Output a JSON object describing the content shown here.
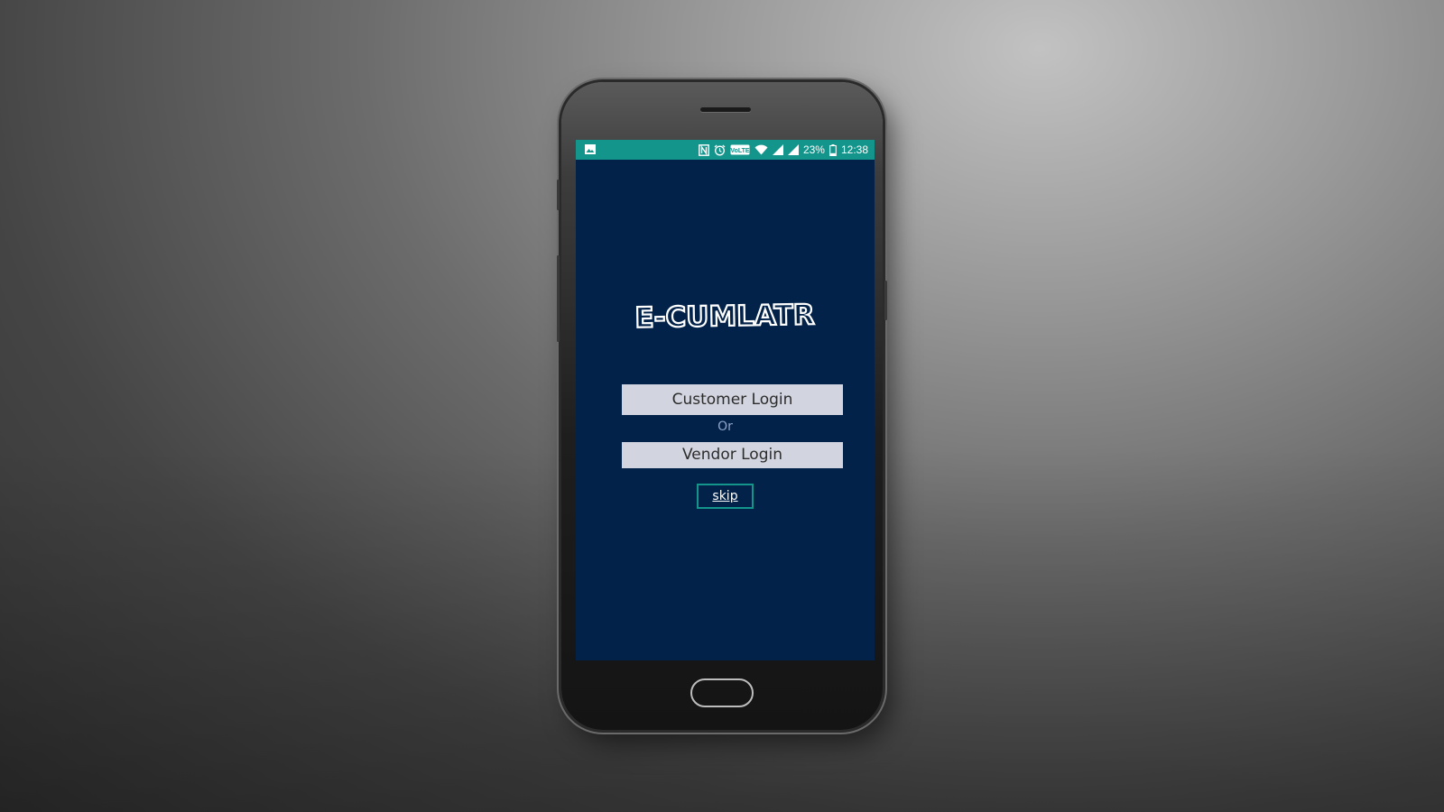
{
  "status_bar": {
    "battery": "23%",
    "time": "12:38",
    "icons": [
      "image-notification-icon",
      "nfc-icon",
      "alarm-icon",
      "volte-icon",
      "wifi-icon",
      "signal-icon",
      "signal-icon-2",
      "battery-icon"
    ],
    "volte_label": "VoLTE",
    "color": "#14958b"
  },
  "app": {
    "logo_text": "E-CUMLATR",
    "background": "#022249",
    "customer_login_label": "Customer Login",
    "or_label": "Or",
    "vendor_login_label": "Vendor Login",
    "skip_label": "skip"
  }
}
